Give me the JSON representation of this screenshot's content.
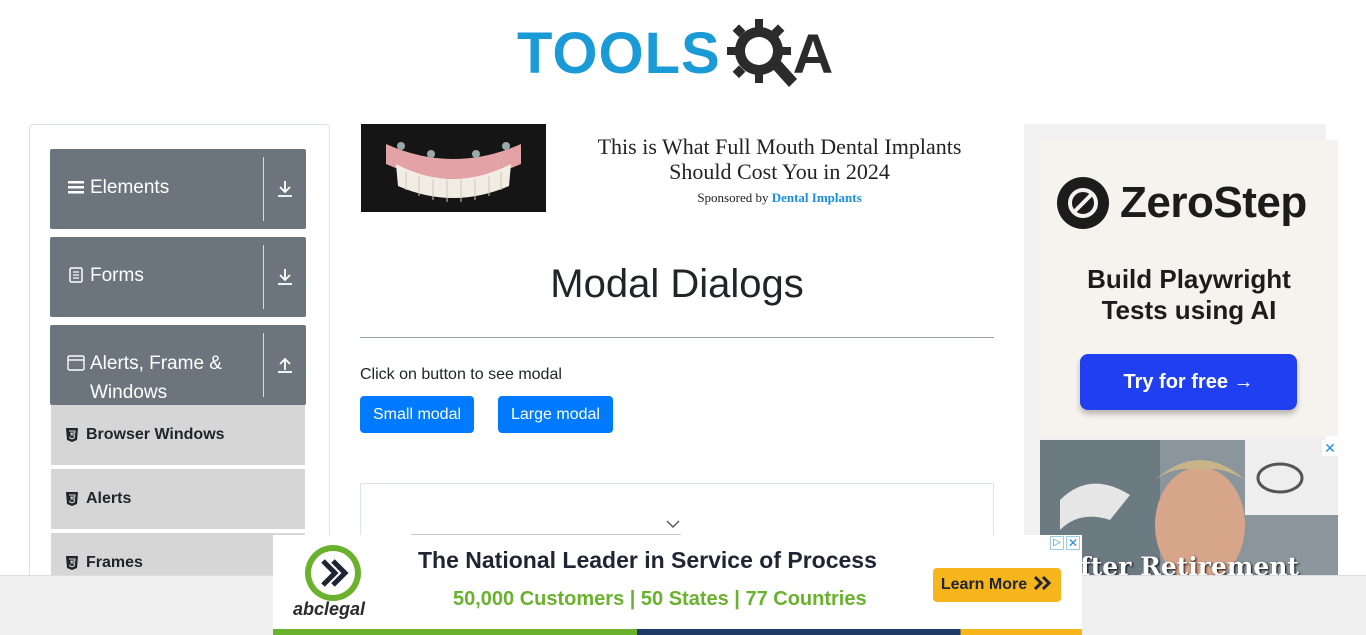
{
  "header": {
    "logo_text_part1": "TOOLS",
    "logo_text_part2": "A"
  },
  "sidebar": {
    "groups": [
      {
        "label": "Elements",
        "icon": "hamburger-icon",
        "arrow": "download-arrow-icon"
      },
      {
        "label": "Forms",
        "icon": "document-icon",
        "arrow": "download-arrow-icon"
      },
      {
        "label": "Alerts, Frame & Windows",
        "label_line1": "Alerts, Frame &",
        "label_line2": "Windows",
        "icon": "window-icon",
        "arrow": "upload-arrow-icon"
      }
    ],
    "sub_items": [
      {
        "label": "Browser Windows",
        "icon": "html5-icon"
      },
      {
        "label": "Alerts",
        "icon": "html5-icon"
      },
      {
        "label": "Frames",
        "icon": "html5-icon"
      }
    ]
  },
  "top_ad": {
    "headline": "This is What Full Mouth Dental Implants Should Cost You in 2024",
    "sponsor_prefix": "Sponsored by",
    "sponsor_brand": "Dental Implants"
  },
  "main": {
    "title": "Modal Dialogs",
    "instruction": "Click on button to see modal",
    "small_modal_button": "Small modal",
    "large_modal_button": "Large modal"
  },
  "right_ad": {
    "brand": "ZeroStep",
    "tagline_line1": "Build Playwright",
    "tagline_line2": "Tests using AI",
    "cta": "Try for free →",
    "video_caption": "fter Retirement",
    "close": "✕"
  },
  "bottom_banner": {
    "brand": "abclegal",
    "headline": "The National Leader in Service of Process",
    "subline": "50,000 Customers | 50 States | 77 Countries",
    "cta": "Learn More",
    "close": "✕"
  },
  "colors": {
    "brand_blue": "#1a9ad6",
    "sidebar_group": "#6c757d",
    "primary_button": "#007bff",
    "zerostep_button": "#1f3ff0"
  }
}
